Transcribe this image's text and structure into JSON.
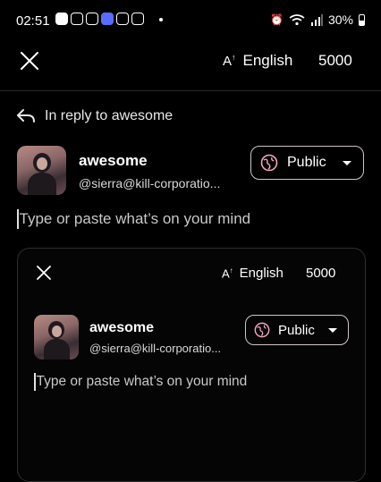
{
  "status_bar": {
    "time": "02:51",
    "battery": "30%",
    "notification_icons": [
      "discord-icon",
      "instagram-icon",
      "instagram-icon",
      "app-icon",
      "twitch-icon",
      "gallery-icon"
    ]
  },
  "header": {
    "language": "English",
    "char_count": "5000"
  },
  "reply": {
    "label": "In reply to awesome"
  },
  "account": {
    "name": "awesome",
    "handle": "@sierra@kill-corporatio..."
  },
  "visibility": {
    "label": "Public"
  },
  "compose": {
    "placeholder": "Type or paste what’s on your mind"
  },
  "inner_preview": {
    "language": "English",
    "char_count": "5000",
    "name": "awesome",
    "handle": "@sierra@kill-corporatio...",
    "visibility": "Public",
    "placeholder": "Type or paste what’s on your mind"
  }
}
